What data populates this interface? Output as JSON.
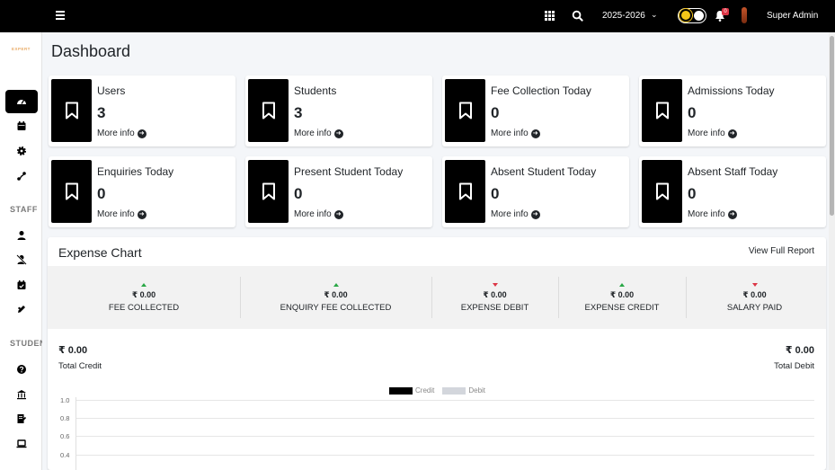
{
  "navbar": {
    "session": "2025-2026",
    "notification_count": "0",
    "user_name": "Super Admin"
  },
  "sidebar": {
    "logo_text": "EXPERT",
    "staff_heading": "STAFF",
    "student_heading": "STUDENT"
  },
  "page": {
    "title": "Dashboard"
  },
  "boxes": [
    {
      "label": "Users",
      "value": "3",
      "more": "More info"
    },
    {
      "label": "Students",
      "value": "3",
      "more": "More info"
    },
    {
      "label": "Fee Collection Today",
      "value": "0",
      "more": "More info"
    },
    {
      "label": "Admissions Today",
      "value": "0",
      "more": "More info"
    },
    {
      "label": "Enquiries Today",
      "value": "0",
      "more": "More info"
    },
    {
      "label": "Present Student Today",
      "value": "0",
      "more": "More info"
    },
    {
      "label": "Absent Student Today",
      "value": "0",
      "more": "More info"
    },
    {
      "label": "Absent Staff Today",
      "value": "0",
      "more": "More info"
    }
  ],
  "expense": {
    "title": "Expense Chart",
    "view_link": "View Full Report",
    "stats": [
      {
        "amount": "₹ 0.00",
        "label": "FEE COLLECTED",
        "trend": "up"
      },
      {
        "amount": "₹ 0.00",
        "label": "ENQUIRY FEE COLLECTED",
        "trend": "up"
      },
      {
        "amount": "₹ 0.00",
        "label": "EXPENSE DEBIT",
        "trend": "down"
      },
      {
        "amount": "₹ 0.00",
        "label": "EXPENSE CREDIT",
        "trend": "up"
      },
      {
        "amount": "₹ 0.00",
        "label": "SALARY PAID",
        "trend": "down"
      }
    ],
    "total_credit": {
      "amount": "₹ 0.00",
      "label": "Total Credit"
    },
    "total_debit": {
      "amount": "₹ 0.00",
      "label": "Total Debit"
    }
  },
  "chart_data": {
    "type": "bar",
    "series": [
      {
        "name": "Credit",
        "color": "#000000",
        "values": []
      },
      {
        "name": "Debit",
        "color": "#d3d6dc",
        "values": []
      }
    ],
    "y_ticks": [
      "1.0",
      "0.8",
      "0.6",
      "0.4"
    ],
    "ylim": [
      0,
      1.0
    ],
    "grid": true,
    "legend": "top-center"
  }
}
